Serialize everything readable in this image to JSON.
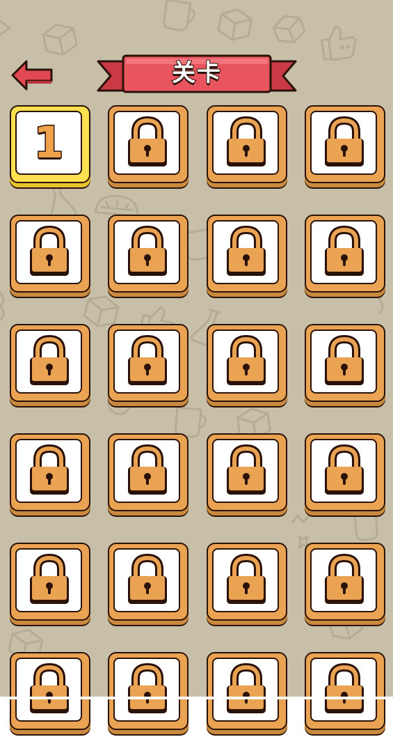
{
  "header": {
    "title": "关卡"
  },
  "levels": [
    {
      "label": "1",
      "locked": false
    },
    {
      "label": "",
      "locked": true
    },
    {
      "label": "",
      "locked": true
    },
    {
      "label": "",
      "locked": true
    },
    {
      "label": "",
      "locked": true
    },
    {
      "label": "",
      "locked": true
    },
    {
      "label": "",
      "locked": true
    },
    {
      "label": "",
      "locked": true
    },
    {
      "label": "",
      "locked": true
    },
    {
      "label": "",
      "locked": true
    },
    {
      "label": "",
      "locked": true
    },
    {
      "label": "",
      "locked": true
    },
    {
      "label": "",
      "locked": true
    },
    {
      "label": "",
      "locked": true
    },
    {
      "label": "",
      "locked": true
    },
    {
      "label": "",
      "locked": true
    },
    {
      "label": "",
      "locked": true
    },
    {
      "label": "",
      "locked": true
    },
    {
      "label": "",
      "locked": true
    },
    {
      "label": "",
      "locked": true
    },
    {
      "label": "",
      "locked": true
    },
    {
      "label": "",
      "locked": true
    },
    {
      "label": "",
      "locked": true
    },
    {
      "label": "",
      "locked": true
    }
  ],
  "colors": {
    "background": "#c8bfa9",
    "banner": "#e9555e",
    "tile_orange": "#e9a352",
    "tile_unlocked": "#fde04f",
    "outline": "#2a1208"
  },
  "icons": {
    "back": "back-arrow-icon",
    "lock": "padlock-icon"
  }
}
